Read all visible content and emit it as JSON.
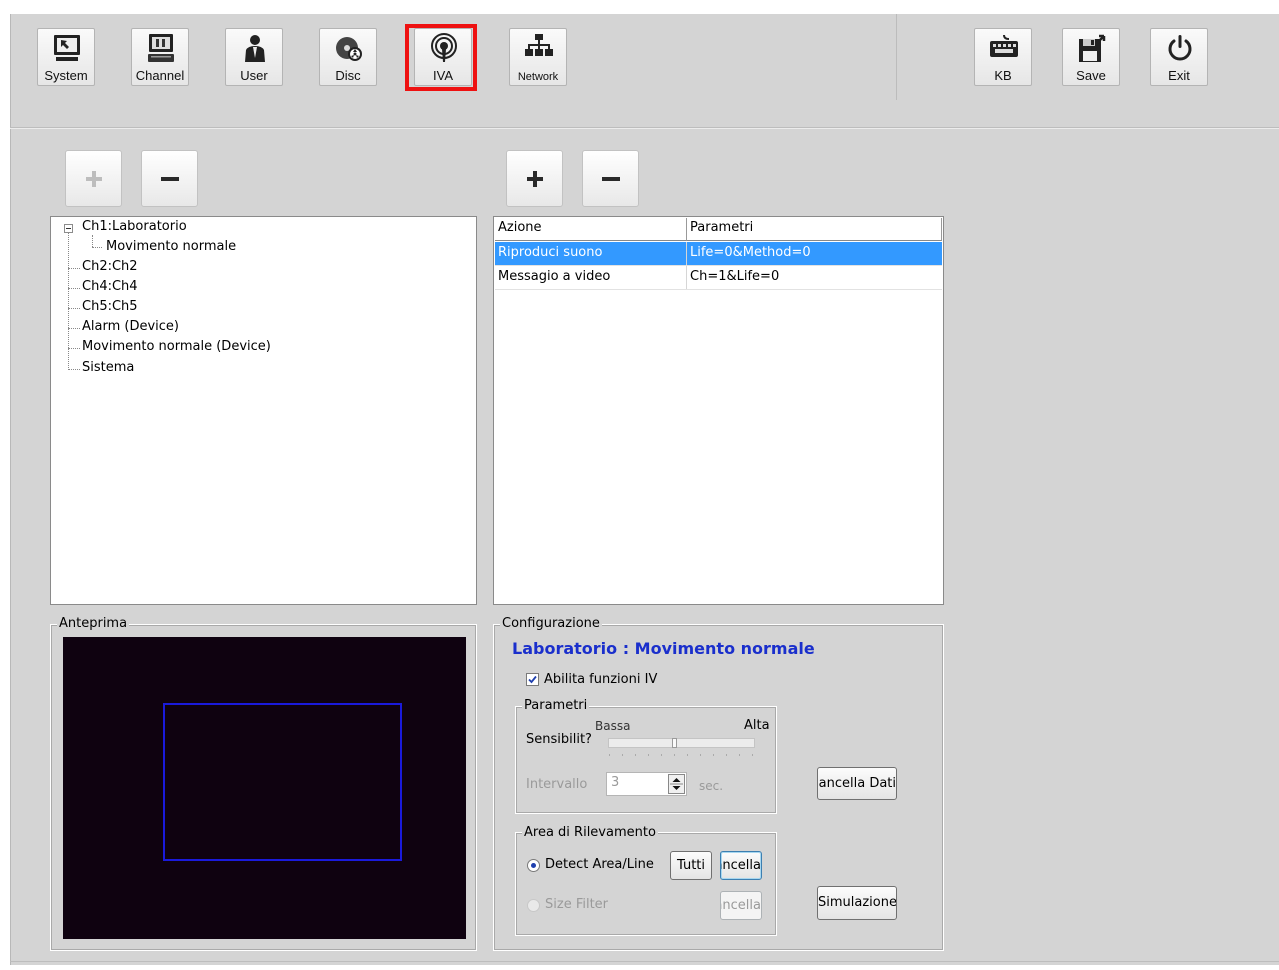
{
  "toolbar": {
    "system": "System",
    "channel": "Channel",
    "user": "User",
    "disc": "Disc",
    "iva": "IVA",
    "network": "Network",
    "kb": "KB",
    "save": "Save",
    "exit": "Exit",
    "selected_color": "#ee1111"
  },
  "tree": {
    "items": [
      "Ch1:Laboratorio",
      "Movimento normale",
      "Ch2:Ch2",
      "Ch4:Ch4",
      "Ch5:Ch5",
      "Alarm (Device)",
      "Movimento normale (Device)",
      "Sistema"
    ]
  },
  "actions": {
    "headers": [
      "Azione",
      "Parametri"
    ],
    "rows": [
      [
        "Riproduci suono",
        "Life=0&Method=0"
      ],
      [
        "Messagio a video",
        "Ch=1&Life=0"
      ]
    ],
    "selected_color": "#3399ff"
  },
  "preview": {
    "title": "Anteprima",
    "background": "#0f0210",
    "rect_color": "#1a1adb"
  },
  "config": {
    "title": "Configurazione",
    "heading": "Laboratorio : Movimento normale",
    "heading_color": "#1a2fcc",
    "enable_label": "Abilita funzioni IV",
    "enable_checked": true,
    "params_title": "Parametri",
    "sens_label": "Sensibilit?",
    "sens_low": "Bassa",
    "sens_high": "Alta",
    "interval_label": "Intervallo",
    "interval_value": "3",
    "interval_unit": "sec.",
    "clear_data": "Cancella Dati",
    "area_title": "Area di Rilevamento",
    "detect_area": "Detect Area/Line",
    "all_button": "Tutti",
    "cancel_button": "Cancella",
    "size_filter": "Size Filter",
    "cancel_button2": "Cancella",
    "simulate": "Simulazione"
  }
}
